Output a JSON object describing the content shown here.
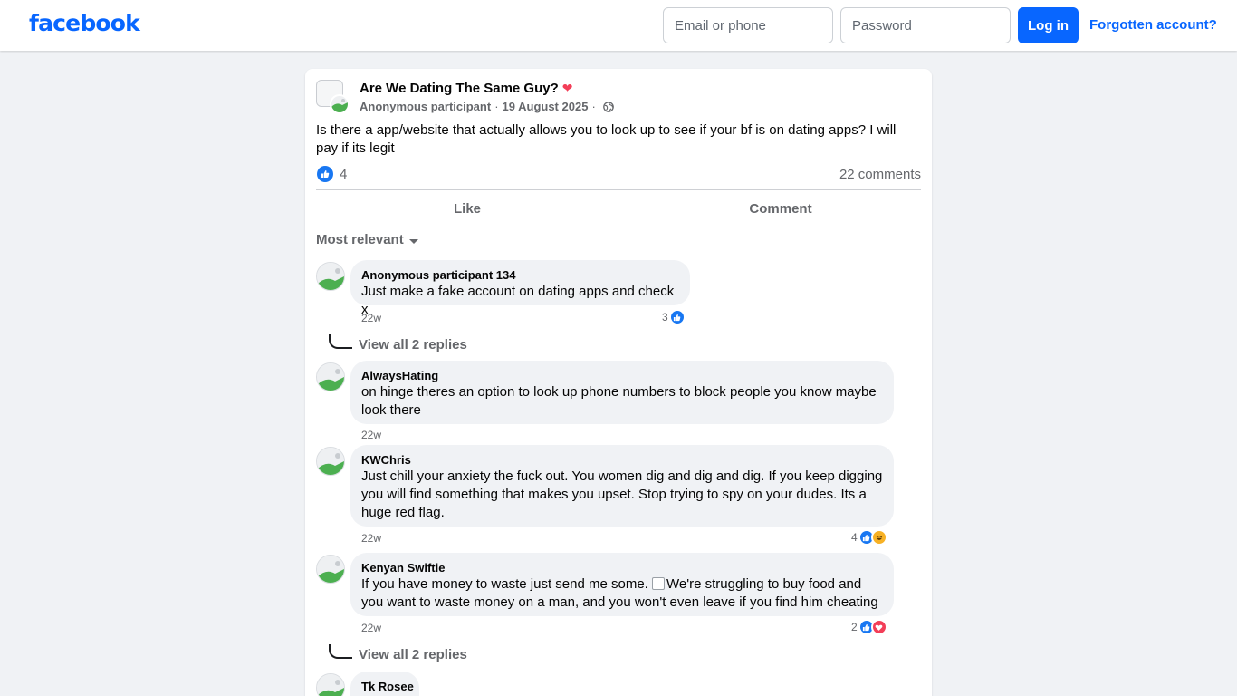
{
  "topbar": {
    "logo": "facebook",
    "email_placeholder": "Email or phone",
    "password_placeholder": "Password",
    "login_label": "Log in",
    "forgot_label": "Forgotten account?"
  },
  "post": {
    "group_name": "Are We Dating The Same Guy?",
    "group_emoji": "❤",
    "author": "Anonymous participant",
    "separator": "·",
    "date": "19 August 2025",
    "body": "Is there a app/website that actually allows you to look up to see if your bf is on dating apps? I will pay if its legit",
    "reaction_count": "4",
    "comments_label": "22 comments",
    "actions": {
      "like": "Like",
      "comment": "Comment"
    },
    "sort_label": "Most relevant"
  },
  "comments": [
    {
      "author": "Anonymous participant 134",
      "text": "Just make a fake account on dating apps and check x",
      "time": "22w",
      "reaction_count": "3",
      "reactions": [
        "like"
      ],
      "replies_label": "View all 2 replies"
    },
    {
      "author": "AlwaysHating",
      "text": "on hinge theres an option to look up phone numbers to block people you know maybe look there",
      "time": "22w"
    },
    {
      "author": "KWChris",
      "text": "Just chill your anxiety the fuck out. You women dig and dig and dig. If you keep digging you will find something that makes you upset. Stop trying to spy on your dudes. Its a huge red flag.",
      "time": "22w",
      "reaction_count": "4",
      "reactions": [
        "like",
        "haha"
      ]
    },
    {
      "author": "Kenyan Swiftie",
      "text_before_image": "If you have money to waste just send me some.",
      "text_after_image": "We're struggling to buy food and you want to waste money on a man, and you won't even leave if you find him cheating",
      "time": "22w",
      "reaction_count": "2",
      "reactions": [
        "like",
        "love"
      ],
      "replies_label": "View all 2 replies"
    },
    {
      "author": "Tk Rosee"
    }
  ],
  "colors": {
    "brand": "#0866ff",
    "background": "#f0f2f5",
    "secondary_text": "#65676b",
    "like_blue": "#1877f2",
    "love_red": "#f33e58",
    "haha_yellow": "#f7b125"
  }
}
